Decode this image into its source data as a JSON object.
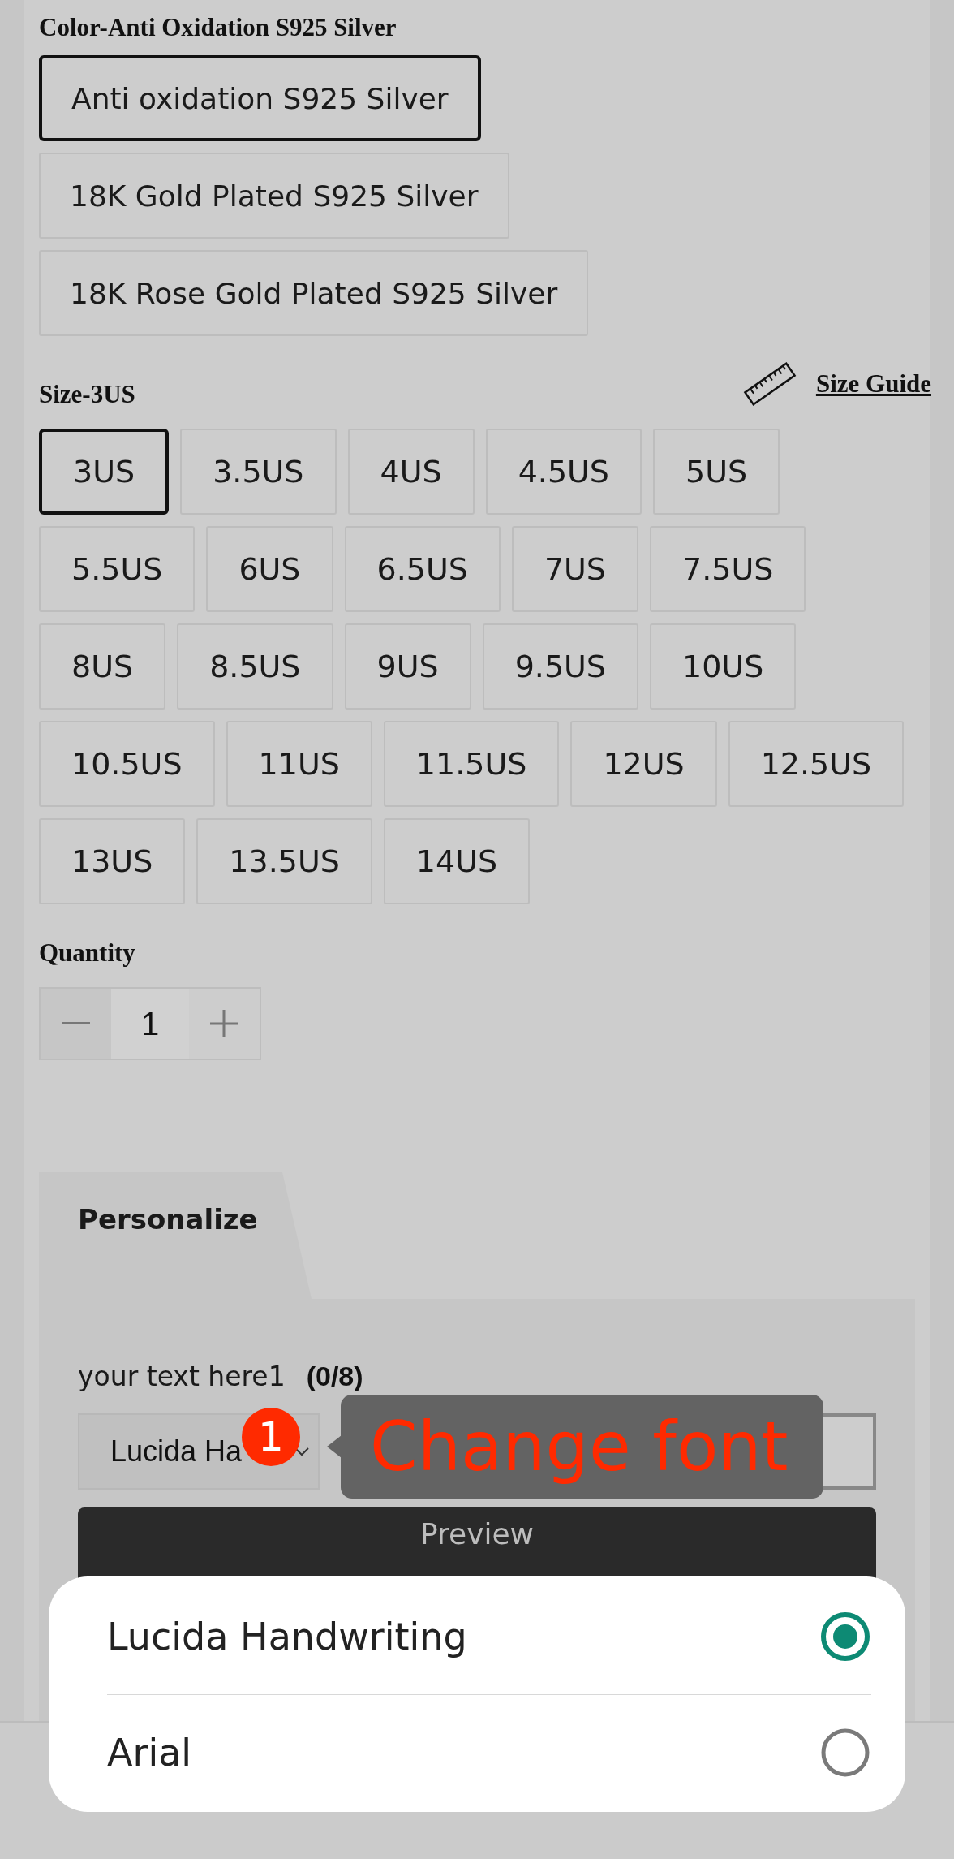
{
  "color_option": {
    "label": "Color-Anti Oxidation S925 Silver",
    "options": [
      {
        "label": "Anti oxidation S925 Silver",
        "selected": true
      },
      {
        "label": "18K Gold Plated S925 Silver",
        "selected": false
      },
      {
        "label": "18K Rose Gold Plated S925 Silver",
        "selected": false
      }
    ]
  },
  "size_option": {
    "label": "Size-3US",
    "size_guide": "Size Guide",
    "options": [
      {
        "label": "3US",
        "selected": true
      },
      {
        "label": "3.5US",
        "selected": false
      },
      {
        "label": "4US",
        "selected": false
      },
      {
        "label": "4.5US",
        "selected": false
      },
      {
        "label": "5US",
        "selected": false
      },
      {
        "label": "5.5US",
        "selected": false
      },
      {
        "label": "6US",
        "selected": false
      },
      {
        "label": "6.5US",
        "selected": false
      },
      {
        "label": "7US",
        "selected": false
      },
      {
        "label": "7.5US",
        "selected": false
      },
      {
        "label": "8US",
        "selected": false
      },
      {
        "label": "8.5US",
        "selected": false
      },
      {
        "label": "9US",
        "selected": false
      },
      {
        "label": "9.5US",
        "selected": false
      },
      {
        "label": "10US",
        "selected": false
      },
      {
        "label": "10.5US",
        "selected": false
      },
      {
        "label": "11US",
        "selected": false
      },
      {
        "label": "11.5US",
        "selected": false
      },
      {
        "label": "12US",
        "selected": false
      },
      {
        "label": "12.5US",
        "selected": false
      },
      {
        "label": "13US",
        "selected": false
      },
      {
        "label": "13.5US",
        "selected": false
      },
      {
        "label": "14US",
        "selected": false
      }
    ]
  },
  "quantity": {
    "label": "Quantity",
    "value": "1"
  },
  "personalize": {
    "tab": "Personalize",
    "text_label": "your text here1",
    "counter": "(0/8)",
    "font_select": "Lucida Ha",
    "button": "Preview"
  },
  "tooltip": {
    "badge": "1",
    "text": "Change font"
  },
  "font_sheet": {
    "options": [
      {
        "label": "Lucida Handwriting",
        "selected": true
      },
      {
        "label": "Arial",
        "selected": false
      }
    ]
  }
}
